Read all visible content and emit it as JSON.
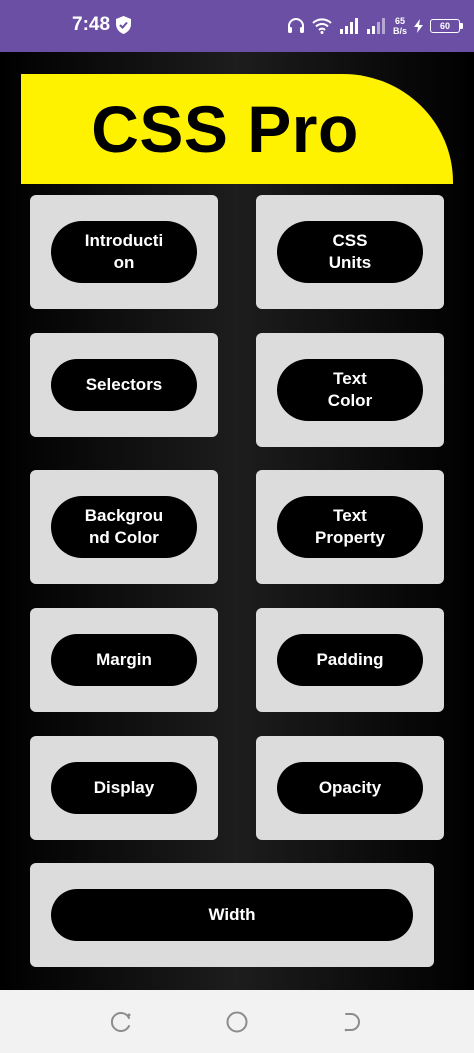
{
  "status": {
    "time": "7:48",
    "speed_value": "65",
    "speed_unit": "B/s",
    "battery": "60"
  },
  "app": {
    "title": "CSS Pro"
  },
  "topics": [
    {
      "label": "Introducti\non"
    },
    {
      "label": "CSS\nUnits"
    },
    {
      "label": "Selectors"
    },
    {
      "label": "Text\nColor"
    },
    {
      "label": "Backgrou\nnd Color"
    },
    {
      "label": "Text\nProperty"
    },
    {
      "label": "Margin"
    },
    {
      "label": "Padding"
    },
    {
      "label": "Display"
    },
    {
      "label": "Opacity"
    },
    {
      "label": "Width"
    }
  ],
  "colors": {
    "status_bar": "#6b4fa4",
    "banner": "#fff200",
    "card": "#dcdcdc",
    "pill": "#000000"
  },
  "nav": {
    "icons": [
      "recent-apps-icon",
      "home-icon",
      "back-icon"
    ]
  }
}
